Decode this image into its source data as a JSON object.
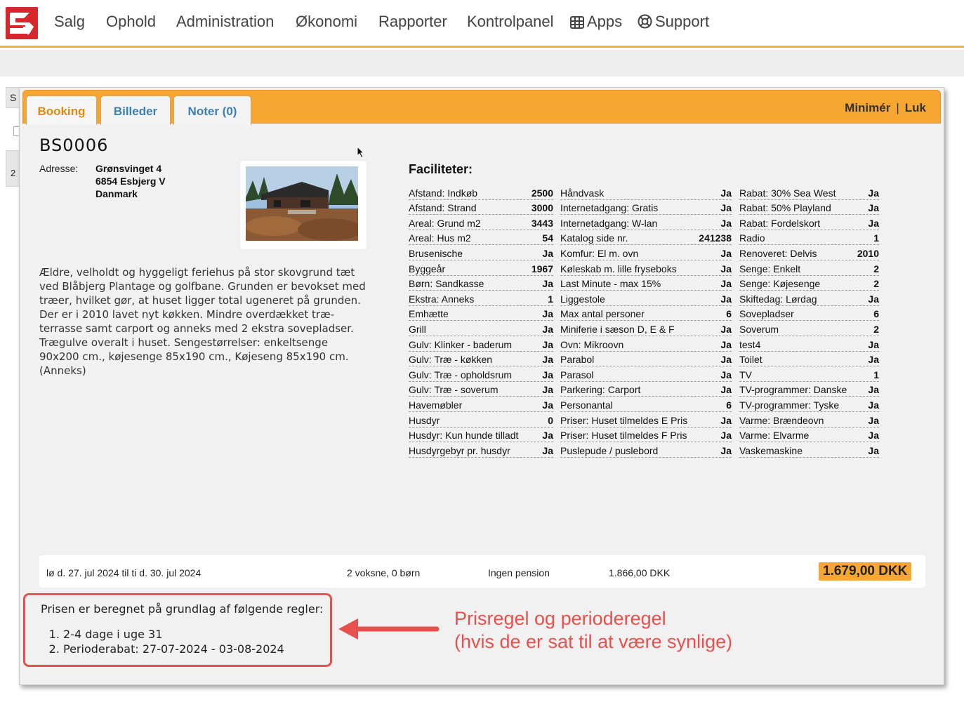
{
  "nav": {
    "items": [
      "Salg",
      "Ophold",
      "Administration",
      "Økonomi",
      "Rapporter",
      "Kontrolpanel"
    ],
    "apps_label": "Apps",
    "support_label": "Support",
    "brand_color": "#d8262d",
    "accent_color": "#f5a731"
  },
  "background": {
    "left_btn": "S",
    "left_num": "2"
  },
  "modal": {
    "tabs": [
      "Booking",
      "Billeder",
      "Noter (0)"
    ],
    "active_tab": "Booking",
    "minimize_label": "Minimér",
    "separator": "|",
    "close_label": "Luk"
  },
  "house": {
    "code": "BS0006",
    "address_label": "Adresse:",
    "address_lines": [
      "Grønsvinget 4",
      "6854 Esbjerg V",
      "Danmark"
    ],
    "description": "Ældre, velholdt og hyggeligt feriehus på stor skovgrund tæt ved Blåbjerg Plantage og golfbane. Grunden er bevokset med træer, hvilket gør, at huset ligger total ugeneret på grunden. Der er i 2010 lavet nyt køkken. Mindre overdækket træ-terrasse samt carport og anneks med 2 ekstra sovepladser. Trægulve overalt i huset. Sengestørrelser: enkeltsenge 90x200 cm., køjesenge 85x190 cm., Køjeseng 85x190 cm. (Anneks)"
  },
  "facilities": {
    "title": "Faciliteter:",
    "columns": [
      [
        [
          "Afstand: Indkøb",
          "2500"
        ],
        [
          "Afstand: Strand",
          "3000"
        ],
        [
          "Areal: Grund m2",
          "3443"
        ],
        [
          "Areal: Hus m2",
          "54"
        ],
        [
          "Brusenische",
          "Ja"
        ],
        [
          "Byggeår",
          "1967"
        ],
        [
          "Børn: Sandkasse",
          "Ja"
        ],
        [
          "Ekstra: Anneks",
          "1"
        ],
        [
          "Emhætte",
          "Ja"
        ],
        [
          "Grill",
          "Ja"
        ],
        [
          "Gulv: Klinker - baderum",
          "Ja"
        ],
        [
          "Gulv: Træ - køkken",
          "Ja"
        ],
        [
          "Gulv: Træ - opholdsrum",
          "Ja"
        ],
        [
          "Gulv: Træ - soverum",
          "Ja"
        ],
        [
          "Havemøbler",
          "Ja"
        ],
        [
          "Husdyr",
          "0"
        ],
        [
          "Husdyr: Kun hunde tilladt",
          "Ja"
        ],
        [
          "Husdyrgebyr pr. husdyr",
          "Ja"
        ]
      ],
      [
        [
          "Håndvask",
          "Ja"
        ],
        [
          "Internetadgang: Gratis",
          "Ja"
        ],
        [
          "Internetadgang: W-lan",
          "Ja"
        ],
        [
          "Katalog side nr.",
          "241238"
        ],
        [
          "Komfur: El m. ovn",
          "Ja"
        ],
        [
          "Køleskab m. lille fryseboks",
          "Ja"
        ],
        [
          "Last Minute - max 15%",
          "Ja"
        ],
        [
          "Liggestole",
          "Ja"
        ],
        [
          "Max antal personer",
          "6"
        ],
        [
          "Miniferie i sæson D, E & F",
          "Ja"
        ],
        [
          "Ovn: Mikroovn",
          "Ja"
        ],
        [
          "Parabol",
          "Ja"
        ],
        [
          "Parasol",
          "Ja"
        ],
        [
          "Parkering: Carport",
          "Ja"
        ],
        [
          "Personantal",
          "6"
        ],
        [
          "Priser: Huset tilmeldes E Pris",
          "Ja"
        ],
        [
          "Priser: Huset tilmeldes F Pris",
          "Ja"
        ],
        [
          "Puslepude / puslebord",
          "Ja"
        ]
      ],
      [
        [
          "Rabat: 30% Sea West",
          "Ja"
        ],
        [
          "Rabat: 50% Playland",
          "Ja"
        ],
        [
          "Rabat: Fordelskort",
          "Ja"
        ],
        [
          "Radio",
          "1"
        ],
        [
          "Renoveret: Delvis",
          "2010"
        ],
        [
          "Senge: Enkelt",
          "2"
        ],
        [
          "Senge: Køjesenge",
          "2"
        ],
        [
          "Skiftedag: Lørdag",
          "Ja"
        ],
        [
          "Sovepladser",
          "6"
        ],
        [
          "Soverum",
          "2"
        ],
        [
          "test4",
          "Ja"
        ],
        [
          "Toilet",
          "Ja"
        ],
        [
          "TV",
          "1"
        ],
        [
          "TV-programmer: Danske",
          "Ja"
        ],
        [
          "TV-programmer: Tyske",
          "Ja"
        ],
        [
          "Varme: Brændeovn",
          "Ja"
        ],
        [
          "Varme: Elvarme",
          "Ja"
        ],
        [
          "Vaskemaskine",
          "Ja"
        ]
      ]
    ]
  },
  "summary": {
    "period": "lø d. 27. jul 2024 til ti d. 30. jul 2024",
    "persons": "2 voksne, 0 børn",
    "pension": "Ingen pension",
    "original_price": "1.866,00 DKK",
    "price": "1.679,00 DKK"
  },
  "rules": {
    "intro": "Prisen er beregnet på grundlag af følgende regler:",
    "items": [
      "2-4 dage i uge 31",
      "Perioderabat: 27-07-2024 - 03-08-2024"
    ]
  },
  "annotation": {
    "line1": "Prisregel og perioderegel",
    "line2": "(hvis de er sat til at være synlige)",
    "color": "#e8504d"
  }
}
